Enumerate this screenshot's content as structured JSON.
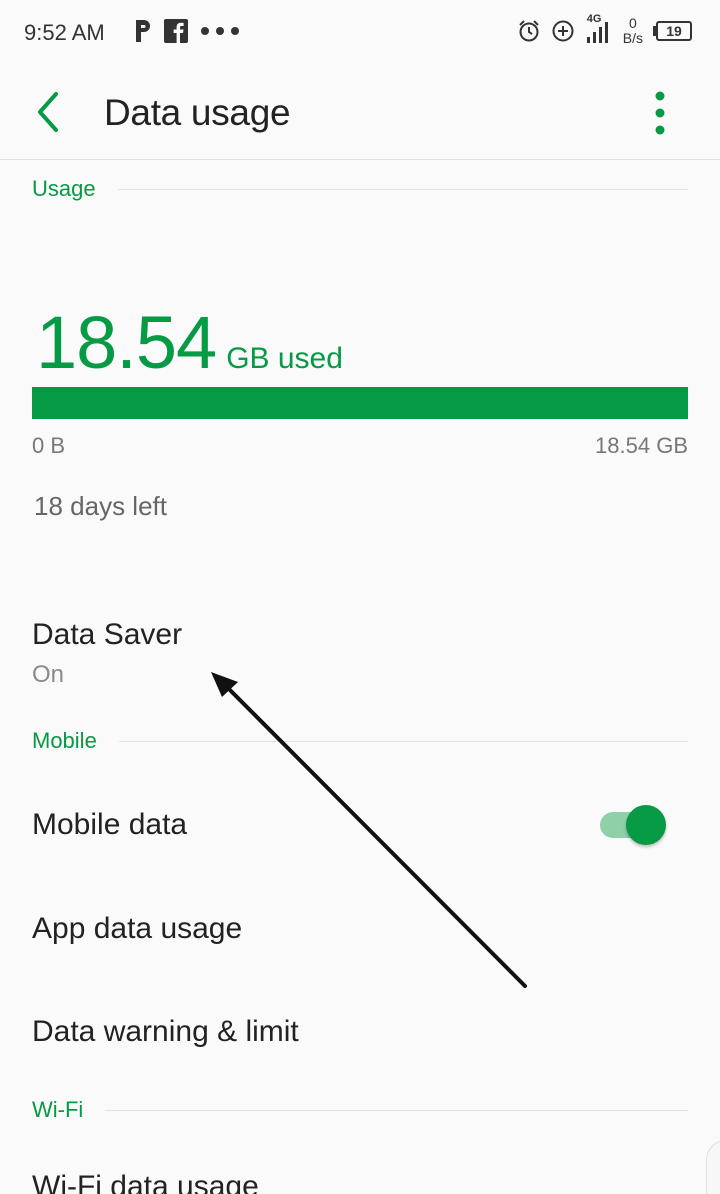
{
  "status_bar": {
    "time": "9:52 AM",
    "network_type": "4G",
    "speed_value": "0",
    "speed_unit": "B/s",
    "battery": "19"
  },
  "app_bar": {
    "title": "Data usage"
  },
  "usage": {
    "section_label": "Usage",
    "amount": "18.54",
    "unit": "GB used",
    "fill_fraction": 1.0,
    "bar_min": "0 B",
    "bar_max": "18.54 GB",
    "days_left": "18 days left"
  },
  "data_saver": {
    "title": "Data Saver",
    "status": "On"
  },
  "mobile": {
    "section_label": "Mobile",
    "mobile_data_label": "Mobile data",
    "mobile_data_on": true,
    "app_data_usage_label": "App data usage",
    "data_warning_label": "Data warning & limit"
  },
  "wifi": {
    "section_label": "Wi-Fi",
    "wifi_data_usage_label": "Wi-Fi data usage"
  },
  "colors": {
    "accent": "#069a44",
    "toggle_track": "#8fd0a9"
  },
  "icons": {
    "back": "back-arrow-icon",
    "overflow": "more-vert-icon",
    "alarm": "alarm-icon",
    "data_saver": "data-saver-icon",
    "signal": "signal-icon",
    "battery": "battery-icon"
  }
}
